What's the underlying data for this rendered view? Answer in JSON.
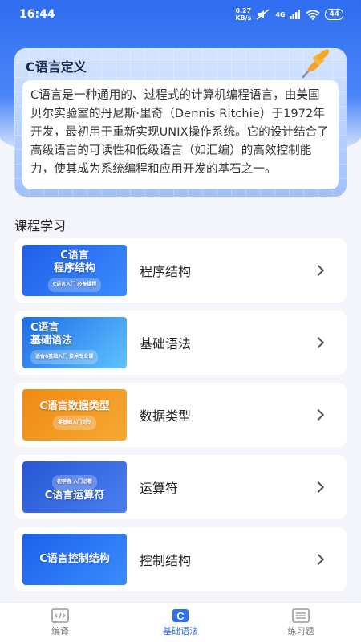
{
  "status_bar": {
    "time": "16:44",
    "net_speed_value": "0.27",
    "net_speed_unit": "KB/s",
    "network_type": "4G",
    "battery": "44"
  },
  "definition": {
    "title": "C语言定义",
    "body": "C语言是一种通用的、过程式的计算机编程语言，由美国贝尔实验室的丹尼斯·里奇（Dennis Ritchie）于1972年开发，最初用于重新实现UNIX操作系统。它的设计结合了高级语言的可读性和低级语言（如汇编）的高效控制能力，使其成为系统编程和应用开发的基石之一。"
  },
  "courses": {
    "section_title": "课程学习",
    "items": [
      {
        "label": "程序结构",
        "thumb_title": "C语言\n程序结构",
        "thumb_sub": "C语言入门 必备课程",
        "color_a": "#1f5ee8",
        "color_b": "#3b8cff"
      },
      {
        "label": "基础语法",
        "thumb_title": "C语言\n基础语法",
        "thumb_sub": "适合0基础入门 技术专业课",
        "color_a": "#1e6be6",
        "color_b": "#5fc3ff"
      },
      {
        "label": "数据类型",
        "thumb_title": "C语言数据类型",
        "thumb_sub": "零基础入门到专",
        "color_a": "#f08a14",
        "color_b": "#f6a932"
      },
      {
        "label": "运算符",
        "thumb_title": "C语言运算符",
        "thumb_sub": "初学者 入门必看",
        "color_a": "#2757d6",
        "color_b": "#4a7ff0"
      },
      {
        "label": "控制结构",
        "thumb_title": "C语言控制结构",
        "thumb_sub": "",
        "color_a": "#1c62ea",
        "color_b": "#3a8bff"
      }
    ]
  },
  "bottom_nav": {
    "items": [
      {
        "label": "编译",
        "icon": "code-icon"
      },
      {
        "label": "基础语法",
        "icon": "c-language-icon"
      },
      {
        "label": "练习题",
        "icon": "list-icon"
      }
    ],
    "active_color": "#2f6df1"
  }
}
